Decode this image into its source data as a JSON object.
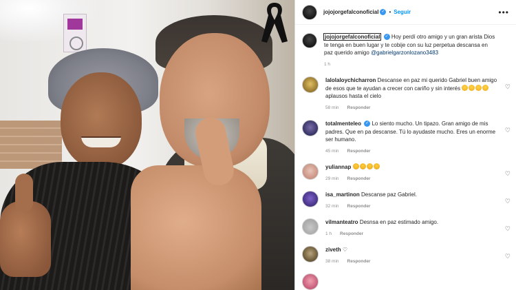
{
  "post": {
    "username": "jojojorgefalconoficial",
    "follow_label": "Seguir",
    "separator": "•",
    "more_label": "•••",
    "caption": {
      "username": "jojojorgefalconoficial",
      "text": "Hoy perdí otro amigo y un gran arista Dios te tenga en buen lugar y te cobije con su luz perpetua descansa en paz querido amigo",
      "mention": "@gabrielgarzonlozano3483",
      "time": "1 h"
    },
    "colors": {
      "link": "#0095f6",
      "verified": "#3897f0",
      "muted": "#8e8e8e"
    }
  },
  "comments": [
    {
      "username": "lalolaloychicharron",
      "text": "Descanse en paz mi querido Gabriel buen amigo de esos que te ayudan a crecer con cariño y sin interés",
      "emoji_count": 4,
      "text_after": "aplausos hasta el cielo",
      "time": "58 min",
      "reply": "Responder"
    },
    {
      "username": "totalmenteleo",
      "verified": true,
      "text": "Lo siento mucho. Un tipazo. Gran amigo de mis padres. Que en pa descanse. Tú lo ayudaste mucho. Eres un enorme ser humano.",
      "time": "45 min",
      "reply": "Responder"
    },
    {
      "username": "yuliannap",
      "emoji_count": 4,
      "time": "29 min",
      "reply": "Responder"
    },
    {
      "username": "isa_martinon",
      "text": "Descanse paz Gabriel.",
      "time": "32 min",
      "reply": "Responder"
    },
    {
      "username": "vilmanteatro",
      "text": "Desnsa en paz estimado amigo.",
      "time": "1 h",
      "reply": "Responder"
    },
    {
      "username": "ziveth",
      "text": "♡",
      "time": "38 min",
      "reply": "Responder"
    }
  ],
  "icons": {
    "like": "heart-outline-icon",
    "verified": "verified-badge-icon",
    "ribbon": "black-mourning-ribbon-icon",
    "heart_glyph": "♡",
    "check_glyph": "✓"
  }
}
